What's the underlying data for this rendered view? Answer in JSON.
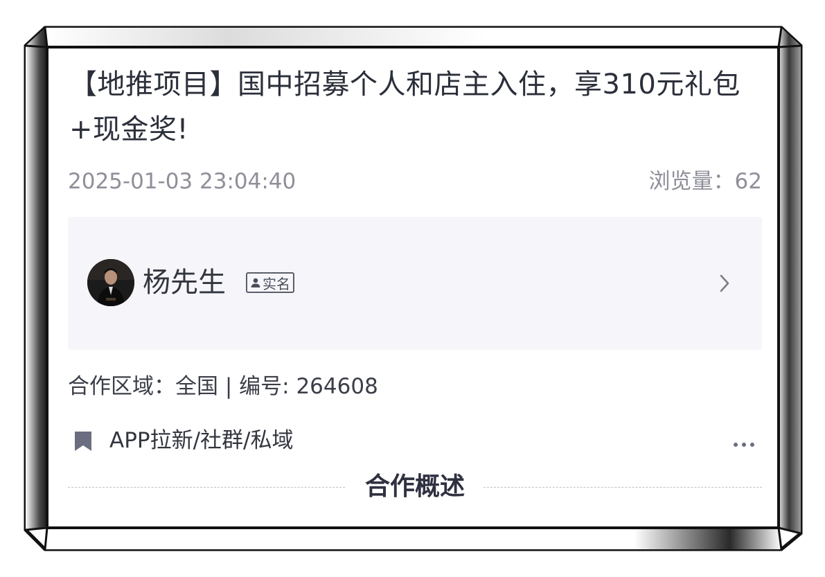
{
  "post": {
    "title": "【地推项目】国中招募个人和店主入住，享310元礼包+现金奖!",
    "published_at": "2025-01-03 23:04:40",
    "views_label": "浏览量：62"
  },
  "publisher": {
    "name": "杨先生",
    "badge": "实名"
  },
  "details": {
    "info_line": "合作区域：全国 | 编号: 264608",
    "tag": "APP拉新/社群/私域"
  },
  "section": {
    "title": "合作概述"
  },
  "colors": {
    "title_text": "#2b2f3a",
    "meta_text": "#8e8f99",
    "panel_bg": "#f6f6fa",
    "icon_gray": "#6b6d80",
    "frame": "#111111"
  },
  "icons": [
    "person-icon",
    "chevron-right-icon",
    "bookmark-icon",
    "more-dots-icon"
  ]
}
